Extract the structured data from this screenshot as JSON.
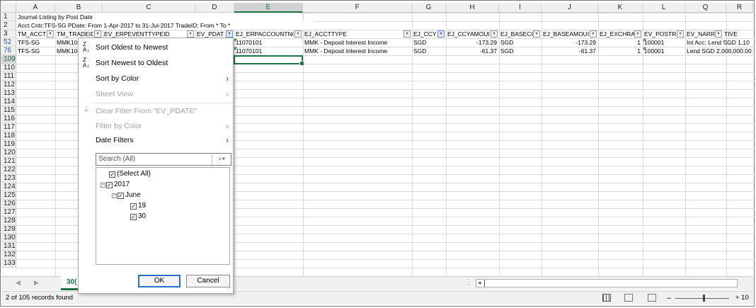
{
  "columns": [
    "A",
    "B",
    "C",
    "D",
    "E",
    "F",
    "G",
    "H",
    "I",
    "J",
    "K",
    "L",
    "Q",
    "R"
  ],
  "rows": {
    "r1": {
      "num": "1",
      "text": "Journal Listing by Post Date"
    },
    "r2": {
      "num": "2",
      "text": "Acct Cntr:TFS-SG PDate: From  1-Apr-2017 to  31-Jul-2017 TradeID: From * To *"
    },
    "r3num": "3",
    "headers": [
      "TM_ACCT",
      "TM_TRADEID",
      "EV_ERPEVENTTYPEID",
      "EV_PDAT",
      "EJ_ERPACCOUNTNO",
      "EJ_ACCTTYPE",
      "EJ_CCY",
      "EJ_CCYAMOUI",
      "EJ_BASECC",
      "EJ_BASEAMOUI",
      "EJ_EXCHRA",
      "EV_POSTRI",
      "EV_NARR",
      "TIVE"
    ],
    "data": [
      {
        "num": "52",
        "acct": "TFS-SG",
        "trade": "MMK10(",
        "erpacc": "11070101",
        "accttype": "MMK - Deposit Interest Income",
        "ccy": "SGD",
        "ccyamt": "-173.29",
        "baseccy": "SGD",
        "baseamt": "-173.29",
        "exch": "1",
        "postr": "100001",
        "narr": "Int Acc: Lend SGD 1,10"
      },
      {
        "num": "76",
        "acct": "TFS-SG",
        "trade": "MMK10(",
        "erpacc": "11070101",
        "accttype": "MMK - Deposit Interest Income",
        "ccy": "SGD",
        "ccyamt": "-61.37",
        "baseccy": "SGD",
        "baseamt": "-61.37",
        "exch": "1",
        "postr": "100001",
        "narr": "Lend SGD 2,000,000.00"
      }
    ],
    "emptyRows": [
      "109",
      "110",
      "111",
      "112",
      "113",
      "114",
      "115",
      "116",
      "117",
      "118",
      "119",
      "120",
      "121",
      "122",
      "123",
      "124",
      "125",
      "126",
      "127",
      "128",
      "129",
      "130",
      "131",
      "132",
      "133"
    ]
  },
  "dropdown": {
    "sort_oldest": "Sort Oldest to Newest",
    "sort_newest": "Sort Newest to Oldest",
    "sort_color": "Sort by Color",
    "sheet_view": "Sheet View",
    "clear_filter": "Clear Filter From \"EV_PDATE\"",
    "filter_color": "Filter by Color",
    "date_filters": "Date Filters",
    "search_placeholder": "Search (All)",
    "tree": {
      "select_all": "(Select All)",
      "year": "2017",
      "month": "June",
      "day1": "19",
      "day2": "30"
    },
    "ok": "OK",
    "cancel": "Cancel"
  },
  "sheet_tab": "30(",
  "status": {
    "records": "2 of 105 records found",
    "zoom": "+ 10"
  },
  "colors": {
    "excel_green": "#217346",
    "row_blue": "#2b57c5"
  }
}
